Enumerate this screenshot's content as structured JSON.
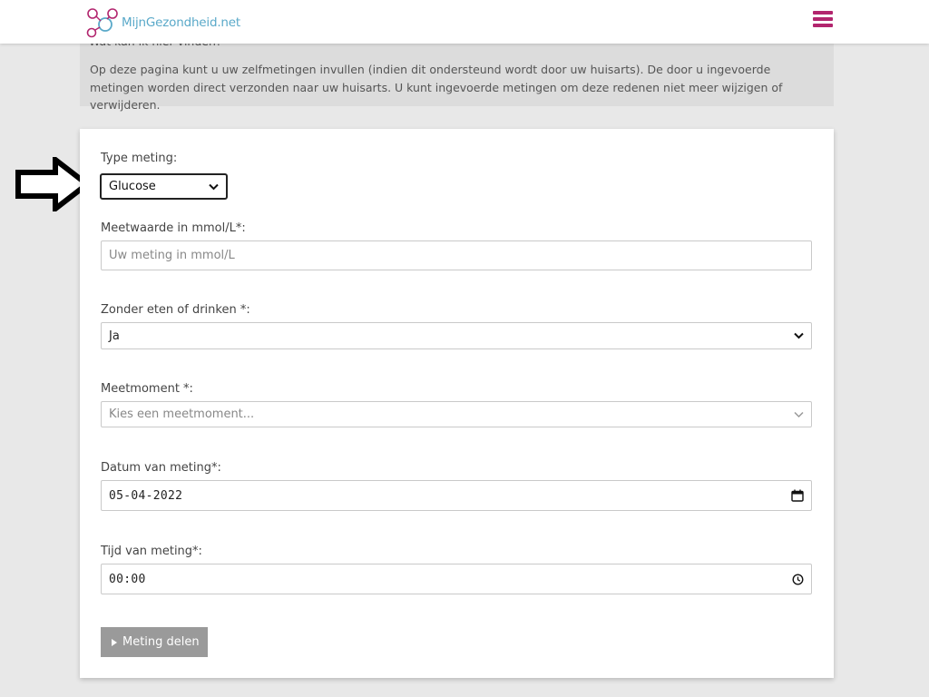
{
  "header": {
    "logo_text": "MijnGezondheid.net"
  },
  "info": {
    "hidden_heading": "Wat kan ik hier vinden?",
    "text": "Op deze pagina kunt u uw zelfmetingen invullen (indien dit ondersteund wordt door uw huisarts). De door u ingevoerde metingen worden direct verzonden naar uw huisarts. U kunt ingevoerde metingen om deze redenen niet meer wijzigen of verwijderen."
  },
  "form": {
    "type_label": "Type meting:",
    "type_value": "Glucose",
    "value_label": "Meetwaarde in mmol/L*:",
    "value_placeholder": "Uw meting in mmol/L",
    "fasting_label": "Zonder eten of drinken *:",
    "fasting_value": "Ja",
    "moment_label": "Meetmoment *:",
    "moment_placeholder": "Kies een meetmoment...",
    "date_label": "Datum van meting*:",
    "date_value": "05-04-2022",
    "time_label": "Tijd van meting*:",
    "time_value": "00:00",
    "submit_label": "Meting delen"
  },
  "colors": {
    "brand_magenta": "#b2256e",
    "logo_blue": "#5aa9c9",
    "button_gray": "#9a9a9a"
  },
  "icons": {
    "menu": "hamburger-menu-icon",
    "calendar": "calendar-icon",
    "clock": "clock-icon",
    "dropdown": "chevron-down-icon",
    "submit": "caret-right-icon",
    "pointer": "arrow-right-icon"
  }
}
